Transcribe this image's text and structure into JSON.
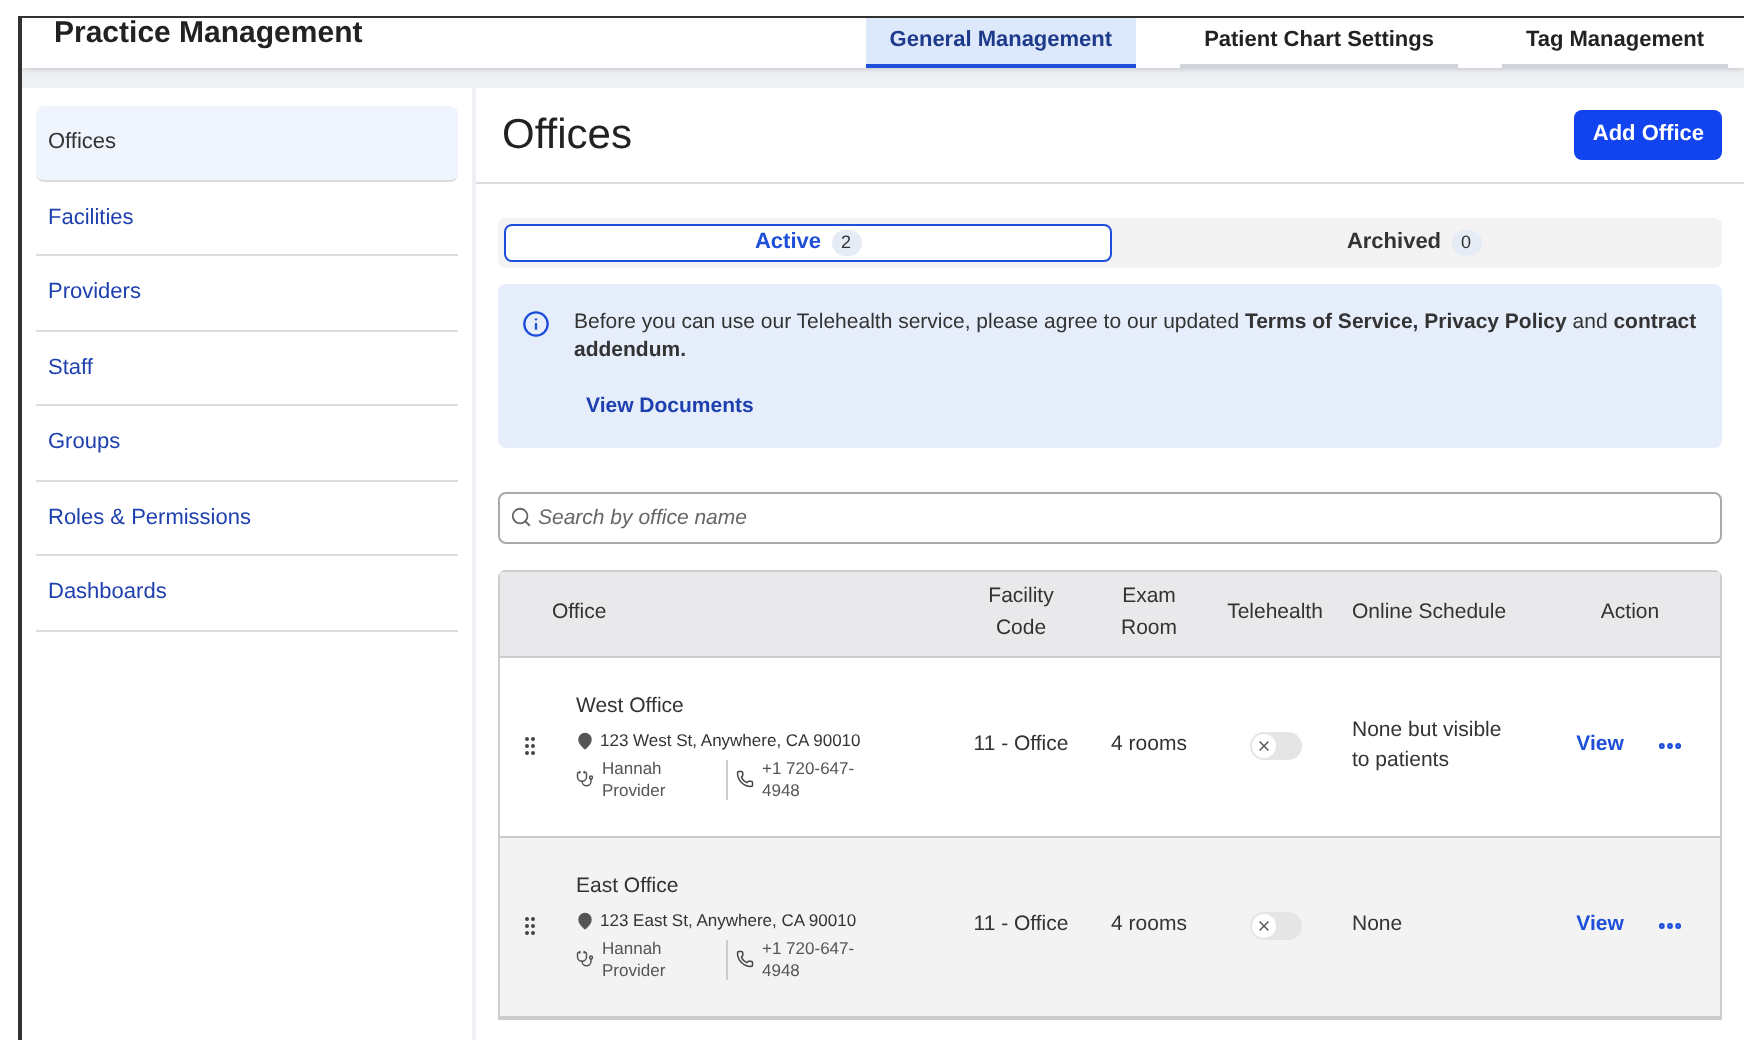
{
  "app_title": "Practice Management",
  "top_tabs": [
    {
      "label": "General Management",
      "selected": true
    },
    {
      "label": "Patient Chart Settings",
      "selected": false
    },
    {
      "label": "Tag Management",
      "selected": false
    }
  ],
  "sidebar": {
    "items": [
      {
        "label": "Offices",
        "selected": true
      },
      {
        "label": "Facilities",
        "selected": false
      },
      {
        "label": "Providers",
        "selected": false
      },
      {
        "label": "Staff",
        "selected": false
      },
      {
        "label": "Groups",
        "selected": false
      },
      {
        "label": "Roles & Permissions",
        "selected": false
      },
      {
        "label": "Dashboards",
        "selected": false
      }
    ]
  },
  "page_title": "Offices",
  "add_button": "Add Office",
  "status_tabs": [
    {
      "label": "Active",
      "count": "2",
      "selected": true
    },
    {
      "label": "Archived",
      "count": "0",
      "selected": false
    }
  ],
  "notice": {
    "text": "Before you can use our Telehealth service, please agree to our updated **Terms of Service, Privacy Policy** and **contract addendum.**",
    "link": "View Documents"
  },
  "search": {
    "placeholder": "Search by office name"
  },
  "table": {
    "columns": [
      "Office",
      "Facility Code",
      "Exam Room",
      "Telehealth",
      "Online Schedule",
      "Action"
    ],
    "rows": [
      {
        "name": "West Office",
        "address": "123 West St, Anywhere, CA 90010",
        "provider": "Hannah Provider",
        "phone": "+1 720-647-4948",
        "facility_code": "11 - Office",
        "exam_room": "4 rooms",
        "telehealth_on": false,
        "online_schedule": "None but visible to patients",
        "action": "View",
        "highlighted": false
      },
      {
        "name": "East Office",
        "address": "123 East St, Anywhere, CA 90010",
        "provider": "Hannah Provider",
        "phone": "+1 720-647-4948",
        "facility_code": "11 - Office",
        "exam_room": "4 rooms",
        "telehealth_on": false,
        "online_schedule": "None",
        "action": "View",
        "highlighted": true
      }
    ]
  }
}
